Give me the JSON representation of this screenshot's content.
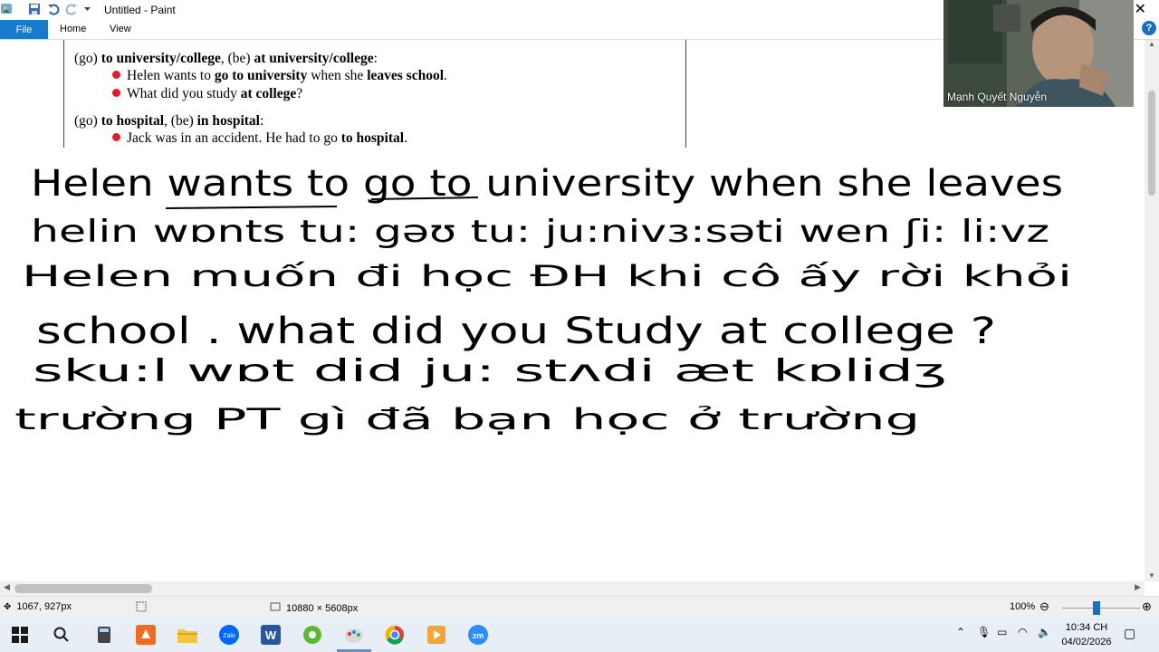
{
  "window": {
    "title": "Untitled - Paint"
  },
  "ribbon": {
    "tabs": [
      "File",
      "Home",
      "View"
    ],
    "help": "?"
  },
  "excerpt": {
    "rule1": {
      "go": "(go) ",
      "to_uni": "to university/college",
      "be": ", (be) ",
      "at_uni": "at university/college",
      "colon": ":"
    },
    "ex1": {
      "a": "Helen wants to ",
      "b": "go to university",
      "c": " when she ",
      "d": "leaves school",
      "e": "."
    },
    "ex2": {
      "a": "What did you study ",
      "b": "at college",
      "c": "?"
    },
    "rule2": {
      "go": "(go) ",
      "to_hosp": "to hospital",
      "be": ", (be) ",
      "in_hosp": "in hospital",
      "colon": ":"
    },
    "ex3": {
      "a": "Jack was in an accident. He had to go ",
      "b": "to hospital",
      "c": "."
    }
  },
  "handwriting": {
    "lines": [
      "Helen wants to go to university when she leaves",
      "helin wɒnts tu: gəʊ tu: ju:nivз:səti wen ʃi: li:vz",
      "Helen muốn đi học ĐH khi cô ấy rời khỏi",
      "school . what did you Study at college ?",
      "sku:l wɒt did ju: stʌdi æt kɒlidʒ",
      "trường PT gì đã bạn học ở trường"
    ],
    "ink_color": "#000000"
  },
  "video": {
    "participant": "Mạnh Quyết Nguyễn"
  },
  "status": {
    "cursor_pos": "1067, 927px",
    "image_size": "10880 × 5608px",
    "zoom": "100%"
  },
  "taskbar": {
    "apps": [
      "start-icon",
      "search-icon",
      "calculator-icon",
      "foxit-icon",
      "file-explorer-icon",
      "zalo-icon",
      "word-icon",
      "edge-icon",
      "paint-icon",
      "chrome-icon",
      "media-icon",
      "zoom-icon"
    ],
    "zalo_label": "Zalo",
    "word_label": "W",
    "zoom_label": "zm",
    "time": "10:34 CH",
    "date": "04/02/2026"
  },
  "colors": {
    "accent": "#1979ca",
    "bullet": "#e01e2a"
  }
}
